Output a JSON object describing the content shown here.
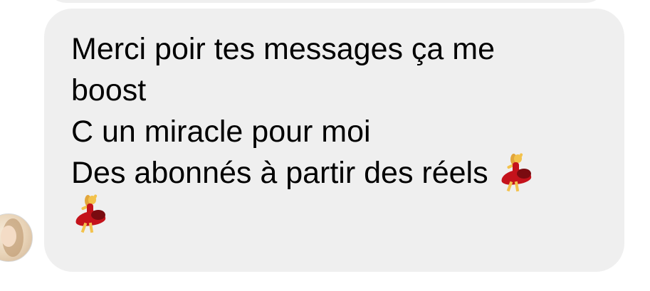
{
  "message": {
    "lines": [
      "Merci poir tes messages ça me",
      "boost",
      "C un miracle pour moi",
      "Des abonnés à partir des réels"
    ],
    "emoji_name": "woman-dancing-emoji"
  }
}
